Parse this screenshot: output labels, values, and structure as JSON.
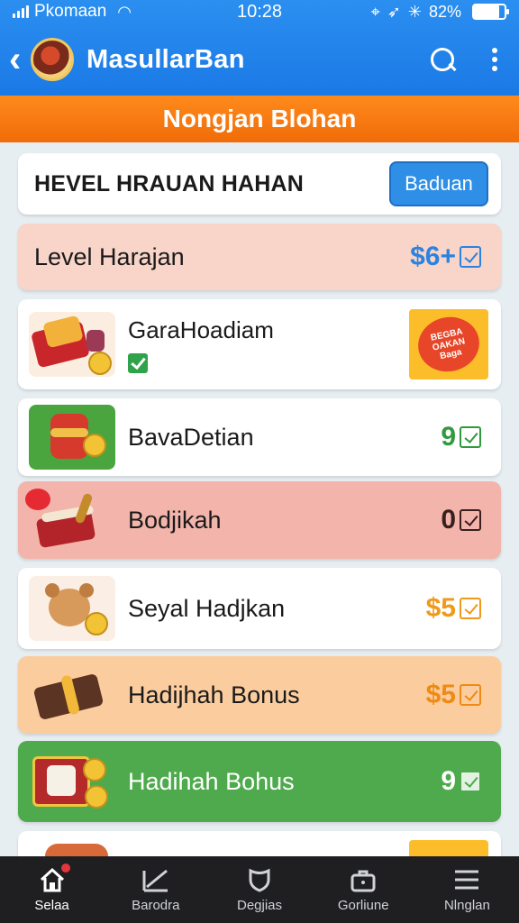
{
  "status": {
    "carrier": "Pkomaan",
    "time": "10:28",
    "battery": "82%",
    "battery_level": 0.82
  },
  "appbar": {
    "title": "MasullarBan"
  },
  "banner": {
    "title": "Nongjan Blohan"
  },
  "list": {
    "header": {
      "label": "HEVEL HRAUAN HAHAN",
      "button": "Baduan"
    },
    "level": {
      "label": "Level Harajan",
      "amount": "$6+"
    },
    "items": [
      {
        "label": "GaraHoadiam",
        "promo": "BEGBA OAKAN Baga"
      },
      {
        "label": "BavaDetian",
        "amount": "9"
      },
      {
        "label": "Bodjikah",
        "amount": "0"
      },
      {
        "label": "Seyal Hadjkan",
        "amount": "$5"
      },
      {
        "label": "Hadijhah Bonus",
        "amount": "$5"
      },
      {
        "label": "Hadihah Bohus",
        "amount": "9"
      }
    ]
  },
  "nav": {
    "items": [
      {
        "label": "Selaa",
        "icon": "home-icon"
      },
      {
        "label": "Barodra",
        "icon": "chart-icon"
      },
      {
        "label": "Degjias",
        "icon": "shield-icon"
      },
      {
        "label": "Gorliune",
        "icon": "briefcase-icon"
      },
      {
        "label": "Nlnglan",
        "icon": "menu-icon"
      }
    ]
  },
  "colors": {
    "primary": "#1b79e6",
    "banner": "#f06c08",
    "green": "#4eaa4c"
  }
}
